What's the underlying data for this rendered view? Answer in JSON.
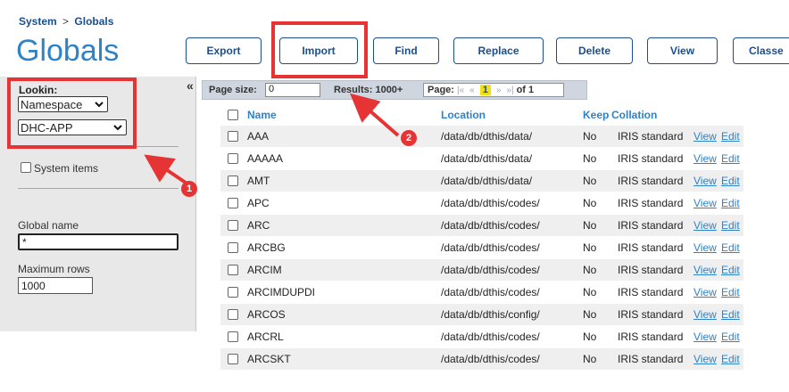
{
  "breadcrumb": {
    "system": "System",
    "separator": ">",
    "current": "Globals"
  },
  "page_title": "Globals",
  "toolbar": {
    "export": "Export",
    "import": "Import",
    "find": "Find",
    "replace": "Replace",
    "delete": "Delete",
    "view": "View",
    "classes": "Classe"
  },
  "sidebar": {
    "collapse": "«",
    "lookin_label": "Lookin:",
    "lookin_type": "Namespace",
    "namespace": "DHC-APP",
    "system_items_label": "System items",
    "global_name_label": "Global name",
    "global_name_value": "*",
    "max_rows_label": "Maximum rows",
    "max_rows_value": "1000"
  },
  "pagebar": {
    "page_size_label": "Page size:",
    "page_size_value": "0",
    "results": "Results: 1000+",
    "page_label": "Page:",
    "first": "|«",
    "prev": "«",
    "current": "1",
    "next": "»",
    "last": "»|",
    "of": "of 1"
  },
  "table": {
    "headers": {
      "name": "Name",
      "location": "Location",
      "keep": "Keep",
      "collation": "Collation"
    },
    "rows": [
      {
        "name": "AAA",
        "location": "/data/db/dthis/data/",
        "keep": "No",
        "collation": "IRIS standard",
        "view": "View",
        "edit": "Edit"
      },
      {
        "name": "AAAAA",
        "location": "/data/db/dthis/data/",
        "keep": "No",
        "collation": "IRIS standard",
        "view": "View",
        "edit": "Edit"
      },
      {
        "name": "AMT",
        "location": "/data/db/dthis/data/",
        "keep": "No",
        "collation": "IRIS standard",
        "view": "View",
        "edit": "Edit"
      },
      {
        "name": "APC",
        "location": "/data/db/dthis/codes/",
        "keep": "No",
        "collation": "IRIS standard",
        "view": "View",
        "edit": "Edit"
      },
      {
        "name": "ARC",
        "location": "/data/db/dthis/codes/",
        "keep": "No",
        "collation": "IRIS standard",
        "view": "View",
        "edit": "Edit"
      },
      {
        "name": "ARCBG",
        "location": "/data/db/dthis/codes/",
        "keep": "No",
        "collation": "IRIS standard",
        "view": "View",
        "edit": "Edit"
      },
      {
        "name": "ARCIM",
        "location": "/data/db/dthis/codes/",
        "keep": "No",
        "collation": "IRIS standard",
        "view": "View",
        "edit": "Edit"
      },
      {
        "name": "ARCIMDUPDI",
        "location": "/data/db/dthis/codes/",
        "keep": "No",
        "collation": "IRIS standard",
        "view": "View",
        "edit": "Edit"
      },
      {
        "name": "ARCOS",
        "location": "/data/db/dthis/config/",
        "keep": "No",
        "collation": "IRIS standard",
        "view": "View",
        "edit": "Edit"
      },
      {
        "name": "ARCRL",
        "location": "/data/db/dthis/codes/",
        "keep": "No",
        "collation": "IRIS standard",
        "view": "View",
        "edit": "Edit"
      },
      {
        "name": "ARCSKT",
        "location": "/data/db/dthis/codes/",
        "keep": "No",
        "collation": "IRIS standard",
        "view": "View",
        "edit": "Edit"
      }
    ]
  },
  "annotations": {
    "callout_1": "1",
    "callout_2": "2"
  },
  "colors": {
    "accent": "#2e82c8",
    "highlight": "#e63434",
    "pager_current": "#f1e018"
  }
}
